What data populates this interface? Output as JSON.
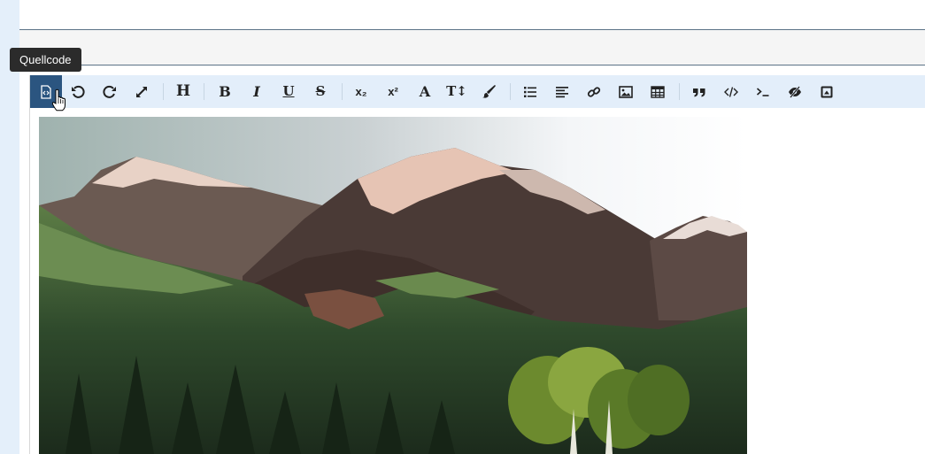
{
  "tooltip": {
    "text": "Quellcode"
  },
  "toolbar": {
    "items": [
      {
        "name": "source-code",
        "icon": "source-code-icon",
        "active": true
      },
      {
        "name": "undo",
        "icon": "undo-icon"
      },
      {
        "name": "redo",
        "icon": "redo-icon"
      },
      {
        "name": "fullscreen",
        "icon": "expand-icon"
      },
      {
        "name": "heading",
        "icon": "heading-icon",
        "glyph": "H"
      },
      {
        "name": "bold",
        "icon": "bold-icon",
        "glyph": "B"
      },
      {
        "name": "italic",
        "icon": "italic-icon",
        "glyph": "I"
      },
      {
        "name": "underline",
        "icon": "underline-icon",
        "glyph": "U"
      },
      {
        "name": "strikethrough",
        "icon": "strikethrough-icon",
        "glyph": "S"
      },
      {
        "name": "subscript",
        "icon": "subscript-icon",
        "glyph": "x₂"
      },
      {
        "name": "superscript",
        "icon": "superscript-icon",
        "glyph": "x²"
      },
      {
        "name": "font",
        "icon": "font-icon",
        "glyph": "A"
      },
      {
        "name": "font-size",
        "icon": "font-size-icon",
        "glyph": "T↕"
      },
      {
        "name": "color",
        "icon": "paintbrush-icon"
      },
      {
        "name": "list",
        "icon": "list-icon"
      },
      {
        "name": "align",
        "icon": "align-left-icon"
      },
      {
        "name": "link",
        "icon": "link-icon"
      },
      {
        "name": "image",
        "icon": "image-icon"
      },
      {
        "name": "table",
        "icon": "table-icon"
      },
      {
        "name": "blockquote",
        "icon": "quote-icon"
      },
      {
        "name": "code",
        "icon": "code-icon"
      },
      {
        "name": "code-block",
        "icon": "terminal-icon"
      },
      {
        "name": "spoiler",
        "icon": "eye-slash-icon"
      },
      {
        "name": "media",
        "icon": "caret-square-up-icon"
      }
    ]
  },
  "colors": {
    "toolbar_bg": "#e3eefa",
    "active_bg": "#2b5580",
    "icon": "#222222",
    "tooltip_bg": "#2b2b2b",
    "gutter": "#e4effa"
  },
  "content": {
    "image": "painting of snow-capped mountains above a green forest"
  }
}
